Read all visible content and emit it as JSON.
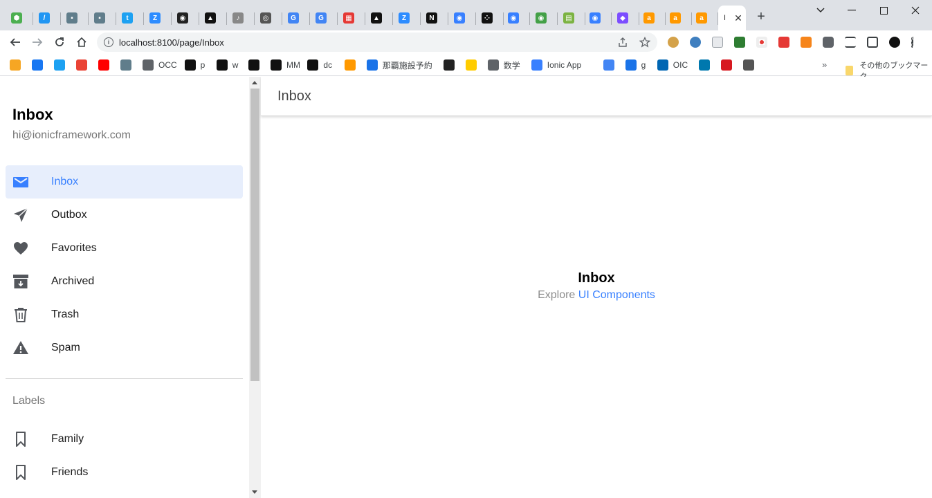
{
  "browser": {
    "tabs": [
      {
        "icon": "node-icon",
        "color": "#4caf50",
        "glyph": "⬢"
      },
      {
        "icon": "slash-icon",
        "color": "#2196f3",
        "glyph": "/"
      },
      {
        "icon": "game-icon",
        "color": "#607d8b",
        "glyph": "▪"
      },
      {
        "icon": "game-icon",
        "color": "#607d8b",
        "glyph": "▪"
      },
      {
        "icon": "twitter-icon",
        "color": "#1da1f2",
        "glyph": "t"
      },
      {
        "icon": "z-icon",
        "color": "#2d8cff",
        "glyph": "Z"
      },
      {
        "icon": "github-icon",
        "color": "#222222",
        "glyph": "◉"
      },
      {
        "icon": "triangle-icon",
        "color": "#111111",
        "glyph": "▲"
      },
      {
        "icon": "audio-icon",
        "color": "#888888",
        "glyph": "♪"
      },
      {
        "icon": "chrome-icon",
        "color": "#555555",
        "glyph": "◎"
      },
      {
        "icon": "google-icon",
        "color": "#4285f4",
        "glyph": "G"
      },
      {
        "icon": "google-icon",
        "color": "#4285f4",
        "glyph": "G"
      },
      {
        "icon": "grid-icon",
        "color": "#e53935",
        "glyph": "▦"
      },
      {
        "icon": "triangle-icon",
        "color": "#111111",
        "glyph": "▲"
      },
      {
        "icon": "z-icon",
        "color": "#2d8cff",
        "glyph": "Z"
      },
      {
        "icon": "n-icon",
        "color": "#111111",
        "glyph": "N"
      },
      {
        "icon": "ionic-icon",
        "color": "#3880ff",
        "glyph": "◉"
      },
      {
        "icon": "dots-icon",
        "color": "#111111",
        "glyph": "⁘"
      },
      {
        "icon": "ionic-icon",
        "color": "#3880ff",
        "glyph": "◉"
      },
      {
        "icon": "circle-icon",
        "color": "#43a047",
        "glyph": "◉"
      },
      {
        "icon": "sheet-icon",
        "color": "#7cb342",
        "glyph": "▤"
      },
      {
        "icon": "ionic-icon",
        "color": "#3880ff",
        "glyph": "◉"
      },
      {
        "icon": "shield-icon",
        "color": "#7c4dff",
        "glyph": "◆"
      },
      {
        "icon": "amazon-icon",
        "color": "#ff9900",
        "glyph": "a"
      },
      {
        "icon": "amazon-icon",
        "color": "#ff9900",
        "glyph": "a"
      },
      {
        "icon": "amazon-icon",
        "color": "#ff9900",
        "glyph": "a"
      }
    ],
    "active_tab_title": "I",
    "url": "localhost:8100/page/Inbox",
    "bookmarks": [
      {
        "icon": "m-icon",
        "color": "#f6a623",
        "label": ""
      },
      {
        "icon": "facebook-icon",
        "color": "#1877f2",
        "label": ""
      },
      {
        "icon": "twitter-icon",
        "color": "#1da1f2",
        "label": ""
      },
      {
        "icon": "gmail-icon",
        "color": "#ea4335",
        "label": ""
      },
      {
        "icon": "youtube-icon",
        "color": "#ff0000",
        "label": ""
      },
      {
        "icon": "game-icon",
        "color": "#607d8b",
        "label": ""
      },
      {
        "icon": "globe-icon",
        "color": "#5f6368",
        "label": "OCC"
      },
      {
        "icon": "dots-icon",
        "color": "#111111",
        "label": "p"
      },
      {
        "icon": "dots-icon",
        "color": "#111111",
        "label": "w"
      },
      {
        "icon": "dots-icon",
        "color": "#111111",
        "label": ""
      },
      {
        "icon": "dots-icon",
        "color": "#111111",
        "label": "MM"
      },
      {
        "icon": "dots-icon",
        "color": "#111111",
        "label": "dc"
      },
      {
        "icon": "amazon-icon",
        "color": "#ff9900",
        "label": ""
      },
      {
        "icon": "chart-icon",
        "color": "#1a73e8",
        "label": "那覇施設予約"
      },
      {
        "icon": "github-icon",
        "color": "#222222",
        "label": ""
      },
      {
        "icon": "cat-icon",
        "color": "#ffcc00",
        "label": ""
      },
      {
        "icon": "globe-icon",
        "color": "#5f6368",
        "label": "数学"
      },
      {
        "icon": "ionic-icon",
        "color": "#3880ff",
        "label": "Ionic App"
      },
      {
        "icon": "google-icon",
        "color": "#4285f4",
        "label": ""
      },
      {
        "icon": "calendar-icon",
        "color": "#1a73e8",
        "label": "g"
      },
      {
        "icon": "jica-icon",
        "color": "#0066b3",
        "label": "OIC"
      },
      {
        "icon": "domino-icon",
        "color": "#0078ae",
        "label": ""
      },
      {
        "icon": "trend-icon",
        "color": "#d71920",
        "label": ""
      },
      {
        "icon": "tool-icon",
        "color": "#555555",
        "label": ""
      }
    ],
    "more_bookmarks": "»",
    "other_bookmarks": "その他のブックマーク"
  },
  "menu": {
    "title": "Inbox",
    "subtitle": "hi@ionicframework.com",
    "items": [
      {
        "label": "Inbox",
        "icon": "mail-icon",
        "selected": true
      },
      {
        "label": "Outbox",
        "icon": "paper-plane-icon",
        "selected": false
      },
      {
        "label": "Favorites",
        "icon": "heart-icon",
        "selected": false
      },
      {
        "label": "Archived",
        "icon": "archive-icon",
        "selected": false
      },
      {
        "label": "Trash",
        "icon": "trash-icon",
        "selected": false
      },
      {
        "label": "Spam",
        "icon": "warning-icon",
        "selected": false
      }
    ],
    "labels_header": "Labels",
    "labels": [
      {
        "label": "Family",
        "icon": "bookmark-icon"
      },
      {
        "label": "Friends",
        "icon": "bookmark-icon"
      }
    ]
  },
  "main": {
    "header_title": "Inbox",
    "content_title": "Inbox",
    "explore_prefix": "Explore",
    "explore_link": "UI Components"
  },
  "colors": {
    "accent": "#3880ff",
    "selected_bg": "#e7eefc",
    "icon_gray": "#54575c"
  }
}
